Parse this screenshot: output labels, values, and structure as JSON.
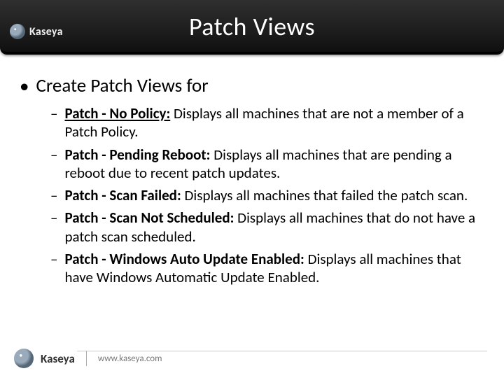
{
  "brand": "Kaseya",
  "title": "Patch Views",
  "lead": "Create Patch Views for",
  "items": [
    {
      "bold": "Patch - No Policy:",
      "text": " Displays all machines that are not a member of a Patch Policy."
    },
    {
      "bold": "Patch - Pending Reboot:",
      "text": " Displays all machines that are pending a reboot due to recent patch updates."
    },
    {
      "bold": "Patch - Scan Failed:",
      "text": " Displays all machines that failed the patch scan."
    },
    {
      "bold": "Patch - Scan Not Scheduled:",
      "text": " Displays all machines that do not have a patch scan scheduled."
    },
    {
      "bold": "Patch - Windows Auto Update Enabled:",
      "text": " Displays all machines that have Windows Automatic Update Enabled."
    }
  ],
  "footer_url": "www.kaseya.com"
}
